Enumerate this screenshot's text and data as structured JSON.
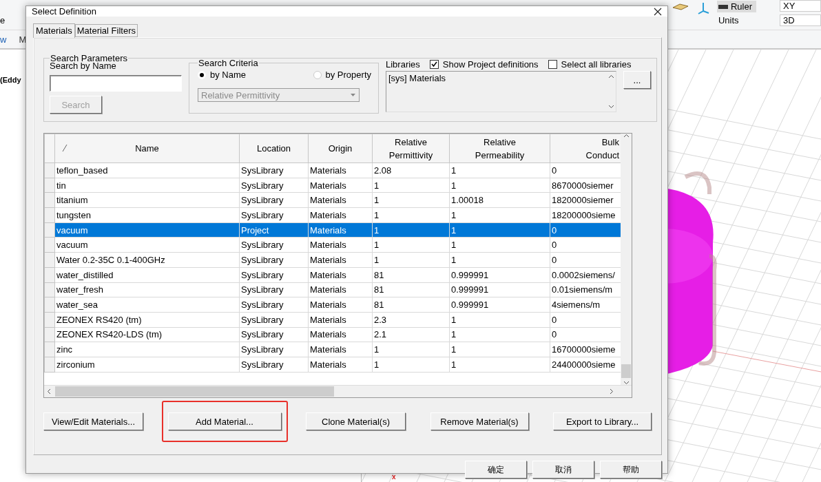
{
  "app": {
    "ribbon": {
      "ruler": "Ruler",
      "units": "Units",
      "plane": "XY",
      "view_mode": "3D",
      "tab_fragments": [
        "w",
        "M"
      ],
      "side_fragment": "e"
    },
    "tree": {
      "item": "(Eddy"
    },
    "viewport": {
      "axis_label": "x"
    }
  },
  "dialog": {
    "title": "Select Definition",
    "tabs": [
      {
        "label": "Materials",
        "selected": true
      },
      {
        "label": "Material Filters",
        "selected": false
      }
    ],
    "search_parameters": {
      "title": "Search Parameters",
      "name_label": "Search by Name",
      "search_button": {
        "label": "Search",
        "disabled": true
      }
    },
    "search_criteria": {
      "title": "Search Criteria",
      "options": [
        {
          "label": "by Name",
          "selected": true
        },
        {
          "label": "by Property",
          "selected": false
        }
      ],
      "property": {
        "value": "Relative Permittivity",
        "disabled": true
      }
    },
    "libraries": {
      "label": "Libraries",
      "show_project": {
        "label": "Show Project definitions",
        "checked": true
      },
      "select_all": {
        "label": "Select all libraries",
        "checked": false
      },
      "items": [
        "[sys] Materials"
      ],
      "browse_button": "..."
    },
    "table": {
      "columns": [
        "Name",
        "Location",
        "Origin",
        "Relative Permittivity",
        "Relative Permeability",
        "Bulk Conduct"
      ],
      "rows": [
        {
          "cells": [
            "teflon_based",
            "SysLibrary",
            "Materials",
            "2.08",
            "1",
            "0"
          ],
          "selected": false
        },
        {
          "cells": [
            "tin",
            "SysLibrary",
            "Materials",
            "1",
            "1",
            "8670000siemer"
          ],
          "selected": false
        },
        {
          "cells": [
            "titanium",
            "SysLibrary",
            "Materials",
            "1",
            "1.00018",
            "1820000siemer"
          ],
          "selected": false
        },
        {
          "cells": [
            "tungsten",
            "SysLibrary",
            "Materials",
            "1",
            "1",
            "18200000sieme"
          ],
          "selected": false
        },
        {
          "cells": [
            "vacuum",
            "Project",
            "Materials",
            "1",
            "1",
            "0"
          ],
          "selected": true
        },
        {
          "cells": [
            "vacuum",
            "SysLibrary",
            "Materials",
            "1",
            "1",
            "0"
          ],
          "selected": false
        },
        {
          "cells": [
            "Water 0.2-35C 0.1-400GHz",
            "SysLibrary",
            "Materials",
            "1",
            "1",
            "0"
          ],
          "selected": false
        },
        {
          "cells": [
            "water_distilled",
            "SysLibrary",
            "Materials",
            "81",
            "0.999991",
            "0.0002siemens/"
          ],
          "selected": false
        },
        {
          "cells": [
            "water_fresh",
            "SysLibrary",
            "Materials",
            "81",
            "0.999991",
            "0.01siemens/m"
          ],
          "selected": false
        },
        {
          "cells": [
            "water_sea",
            "SysLibrary",
            "Materials",
            "81",
            "0.999991",
            "4siemens/m"
          ],
          "selected": false
        },
        {
          "cells": [
            "ZEONEX RS420 (tm)",
            "SysLibrary",
            "Materials",
            "2.3",
            "1",
            "0"
          ],
          "selected": false
        },
        {
          "cells": [
            "ZEONEX RS420-LDS (tm)",
            "SysLibrary",
            "Materials",
            "2.1",
            "1",
            "0"
          ],
          "selected": false
        },
        {
          "cells": [
            "zinc",
            "SysLibrary",
            "Materials",
            "1",
            "1",
            "16700000sieme"
          ],
          "selected": false
        },
        {
          "cells": [
            "zirconium",
            "SysLibrary",
            "Materials",
            "1",
            "1",
            "24400000sieme"
          ],
          "selected": false
        }
      ]
    },
    "actions": [
      {
        "label": "View/Edit Materials...",
        "highlighted": false
      },
      {
        "label": "Add Material...",
        "highlighted": true
      },
      {
        "label": "Clone Material(s)",
        "highlighted": false
      },
      {
        "label": "Remove Material(s)",
        "highlighted": false
      },
      {
        "label": "Export to Library...",
        "highlighted": false
      }
    ],
    "buttons": [
      "确定",
      "取消",
      "帮助"
    ]
  }
}
